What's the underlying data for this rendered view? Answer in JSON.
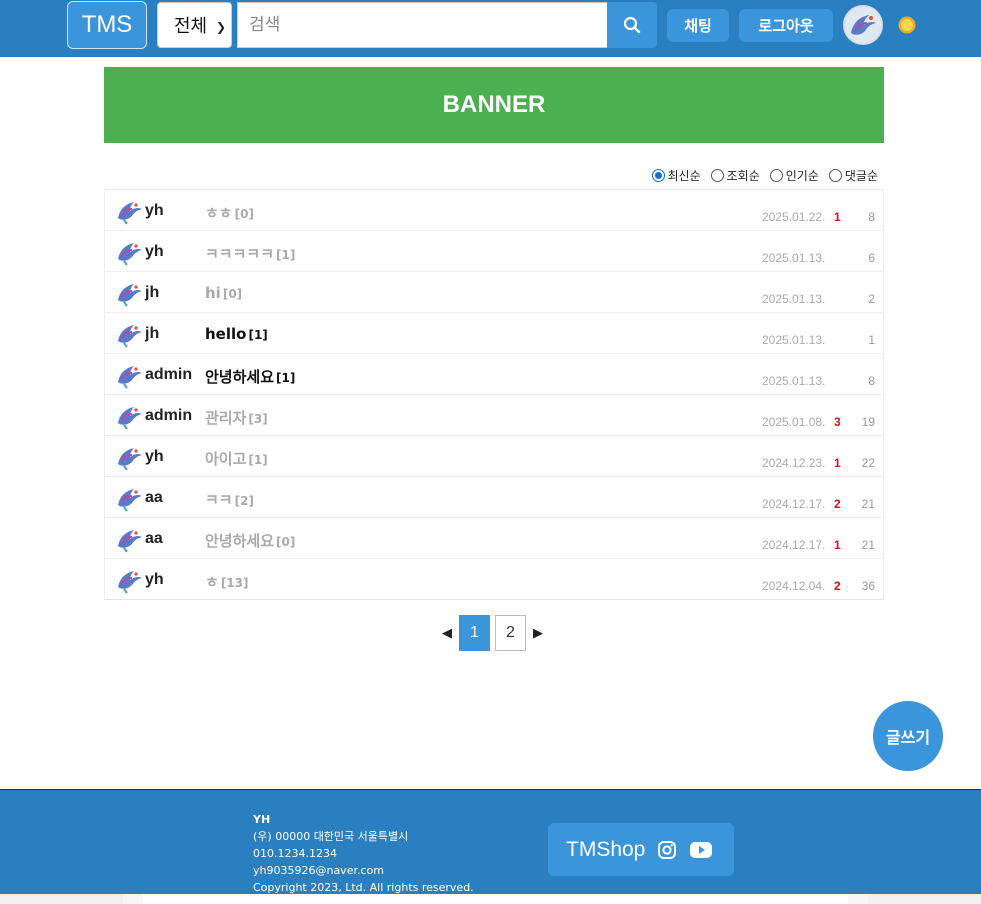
{
  "header": {
    "logo": "TMS",
    "category_selected": "전체",
    "search_placeholder": "검색",
    "chat_label": "채팅",
    "logout_label": "로그아웃"
  },
  "banner": {
    "text": "BANNER"
  },
  "sort": {
    "options": [
      "최신순",
      "조회순",
      "인기순",
      "댓글순"
    ],
    "selected": "최신순"
  },
  "posts": [
    {
      "user": "yh",
      "title": "ㅎㅎ",
      "comments": "[0]",
      "date": "2025.01.22.",
      "likes": "1",
      "views": "8",
      "read": false
    },
    {
      "user": "yh",
      "title": "ㅋㅋㅋㅋㅋ",
      "comments": "[1]",
      "date": "2025.01.13.",
      "likes": "",
      "views": "6",
      "read": false
    },
    {
      "user": "jh",
      "title": "hi",
      "comments": "[0]",
      "date": "2025.01.13.",
      "likes": "",
      "views": "2",
      "read": false
    },
    {
      "user": "jh",
      "title": "hello",
      "comments": "[1]",
      "date": "2025.01.13.",
      "likes": "",
      "views": "1",
      "read": true
    },
    {
      "user": "admin",
      "title": "안녕하세요",
      "comments": "[1]",
      "date": "2025.01.13.",
      "likes": "",
      "views": "8",
      "read": true
    },
    {
      "user": "admin",
      "title": "관리자",
      "comments": "[3]",
      "date": "2025.01.08.",
      "likes": "3",
      "views": "19",
      "read": false
    },
    {
      "user": "yh",
      "title": "아이고",
      "comments": "[1]",
      "date": "2024.12.23.",
      "likes": "1",
      "views": "22",
      "read": false
    },
    {
      "user": "aa",
      "title": "ㅋㅋ",
      "comments": "[2]",
      "date": "2024.12.17.",
      "likes": "2",
      "views": "21",
      "read": false
    },
    {
      "user": "aa",
      "title": "안녕하세요",
      "comments": "[0]",
      "date": "2024.12.17.",
      "likes": "1",
      "views": "21",
      "read": false
    },
    {
      "user": "yh",
      "title": "ㅎ",
      "comments": "[13]",
      "date": "2024.12.04.",
      "likes": "2",
      "views": "36",
      "read": false
    }
  ],
  "pagination": {
    "pages": [
      "1",
      "2"
    ],
    "current": "1"
  },
  "write_button": "글쓰기",
  "footer": {
    "name": "YH",
    "address": "(우) 00000 대한민국 서울특별시",
    "phone": "010.1234.1234",
    "email": "yh9035926@naver.com",
    "copyright": "Copyright 2023, Ltd. All rights reserved.",
    "shop_label": "TMShop"
  },
  "colors": {
    "primary": "#2a7fc0",
    "button": "#3a95db",
    "banner": "#4caf50",
    "like": "#d21414"
  }
}
